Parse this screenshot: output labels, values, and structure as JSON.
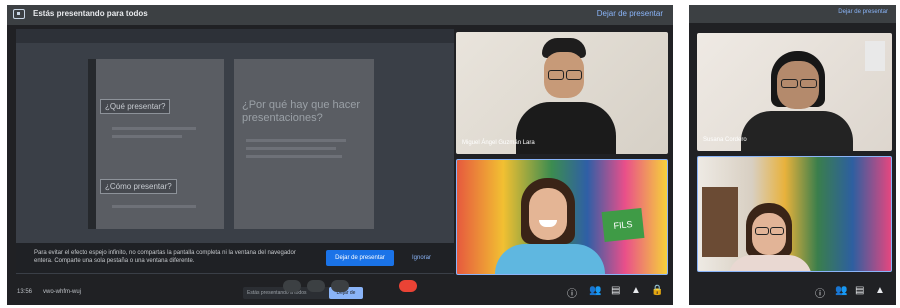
{
  "left_window": {
    "top_bar": {
      "presenting_label": "Estás presentando para todos",
      "stop_label": "Dejar de presentar"
    },
    "slide": {
      "left_heading_1": "¿Qué presentar?",
      "left_heading_2": "¿Cómo presentar?",
      "right_heading": "¿Por qué hay que hacer presentaciones?"
    },
    "banner": {
      "message": "Para evitar el efecto espejo infinito, no compartas la pantalla completa ni la ventana del navegador entera. Comparte una sola pestaña o una ventana diferente.",
      "primary_button": "Dejar de presentar",
      "secondary_button": "Ignorar"
    },
    "participants": [
      {
        "name": "Miguel Ángel Guzmán Lara"
      },
      {
        "name": ""
      }
    ],
    "bottom_bar": {
      "time": "13:56",
      "meeting_code": "vwo-whfm-wuj",
      "hint": "Estás presentando a todos",
      "hint_action": "Dejar de presentar"
    }
  },
  "right_window": {
    "top_bar": {
      "stop_label": "Dejar de presentar"
    },
    "participants": [
      {
        "name": "Susana Cordero"
      },
      {
        "name": ""
      }
    ]
  },
  "colors": {
    "accent": "#1a73e8",
    "bar": "#3c4043",
    "background": "#202124"
  },
  "icons": [
    "present-screen-icon",
    "info-icon",
    "people-icon",
    "chat-icon",
    "activities-icon",
    "lock-icon"
  ]
}
